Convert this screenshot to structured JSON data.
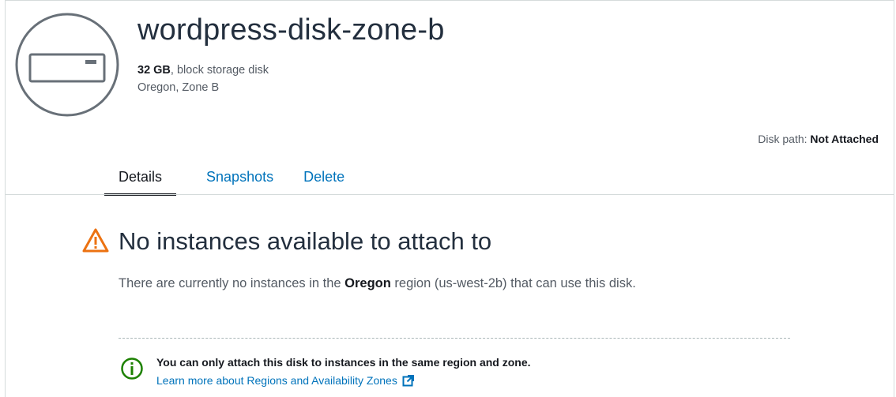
{
  "disk": {
    "name": "wordpress-disk-zone-b",
    "size": "32 GB",
    "type_suffix": ", block storage disk",
    "location": "Oregon, Zone B",
    "path_label": "Disk path: ",
    "path_value": "Not Attached"
  },
  "tabs": [
    {
      "label": "Details",
      "active": true
    },
    {
      "label": "Snapshots",
      "active": false
    },
    {
      "label": "Delete",
      "active": false
    }
  ],
  "warning": {
    "title": "No instances available to attach to",
    "desc_prefix": "There are currently no instances in the ",
    "desc_region": "Oregon",
    "desc_suffix": " region (us-west-2b) that can use this disk."
  },
  "info": {
    "text": "You can only attach this disk to instances in the same region and zone.",
    "link": "Learn more about Regions and Availability Zones"
  },
  "colors": {
    "warning": "#ec7211",
    "success": "#1d8102",
    "link": "#0073bb",
    "icon_gray": "#545b64"
  },
  "icons": {
    "disk": "block-storage-disk-icon",
    "warning": "warning-triangle-icon",
    "info": "info-circle-icon",
    "external": "external-link-icon"
  }
}
